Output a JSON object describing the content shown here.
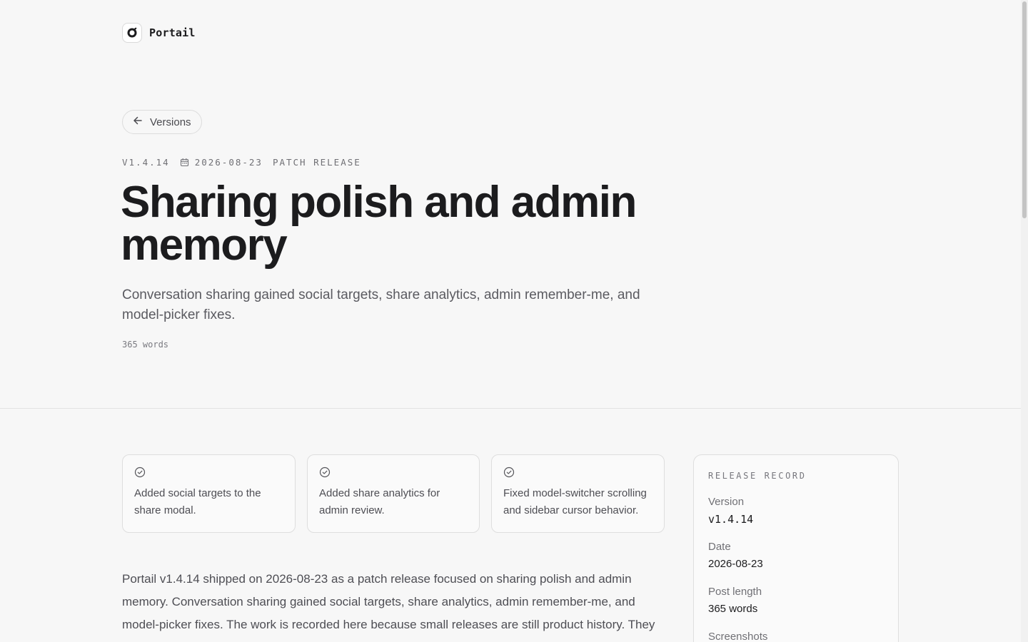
{
  "brand": {
    "name": "Portail",
    "icon": "portail-logo-icon"
  },
  "back_link": {
    "label": "Versions",
    "icon": "arrow-left-icon"
  },
  "meta": {
    "version": "V1.4.14",
    "date": "2026-08-23",
    "type": "PATCH RELEASE",
    "date_icon": "calendar-icon"
  },
  "title": "Sharing polish and admin memory",
  "summary": "Conversation sharing gained social targets, share analytics, admin remember-me, and model-picker fixes.",
  "word_count": "365 words",
  "highlights": [
    {
      "icon": "check-circle-icon",
      "text": "Added social targets to the share modal."
    },
    {
      "icon": "check-circle-icon",
      "text": "Added share analytics for admin review."
    },
    {
      "icon": "check-circle-icon",
      "text": "Fixed model-switcher scrolling and sidebar cursor behavior."
    }
  ],
  "body": "Portail v1.4.14 shipped on 2026-08-23 as a patch release focused on sharing polish and admin memory. Conversation sharing gained social targets, share analytics, admin remember-me, and model-picker fixes. The work is recorded here because small releases are still product history. They",
  "record": {
    "heading": "RELEASE RECORD",
    "rows": [
      {
        "label": "Version",
        "value": "v1.4.14"
      },
      {
        "label": "Date",
        "value": "2026-08-23"
      },
      {
        "label": "Post length",
        "value": "365 words"
      },
      {
        "label": "Screenshots",
        "value": ""
      }
    ]
  },
  "colors": {
    "background": "#f7f7f7",
    "text": "#1c1c1e",
    "muted": "#5a5a60",
    "border": "#dedede"
  }
}
